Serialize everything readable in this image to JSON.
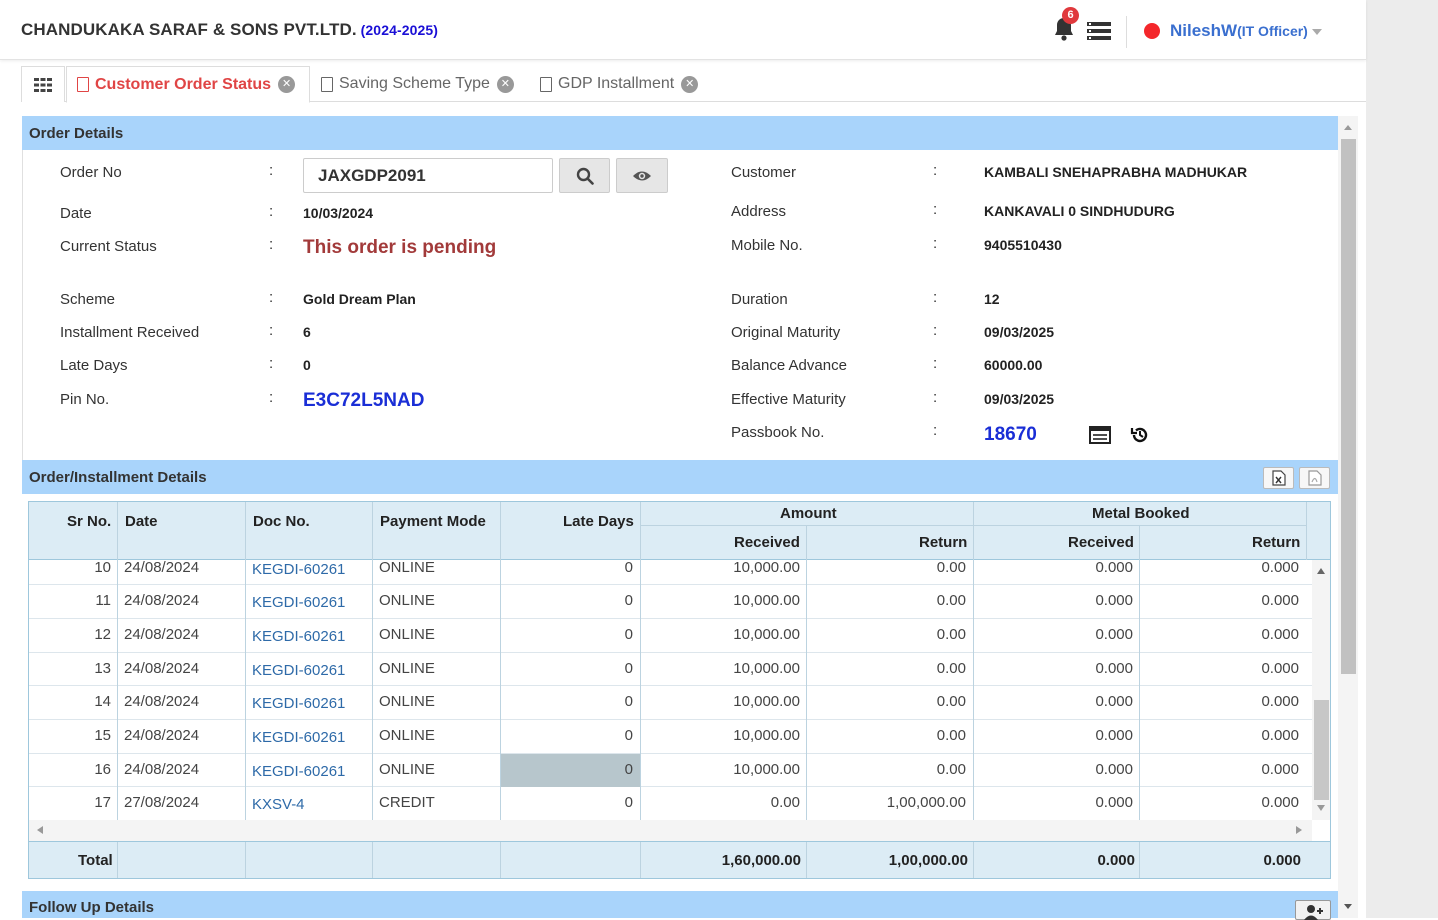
{
  "header": {
    "company": "CHANDUKAKA SARAF & SONS PVT.LTD.",
    "year": "(2024-2025)",
    "notification_count": "6",
    "user_name": "NileshW",
    "user_role": "(IT Officer)",
    "status_color": "#f4272b"
  },
  "tabs": [
    {
      "label": "Customer Order Status",
      "active": true
    },
    {
      "label": "Saving Scheme Type",
      "active": false
    },
    {
      "label": "GDP Installment",
      "active": false
    }
  ],
  "order_details": {
    "title": "Order Details",
    "left": {
      "order_no_label": "Order No",
      "order_no_value": "JAXGDP2091",
      "date_label": "Date",
      "date_value": "10/03/2024",
      "status_label": "Current Status",
      "status_value": "This order is pending",
      "scheme_label": "Scheme",
      "scheme_value": "Gold Dream Plan",
      "installment_label": "Installment Received",
      "installment_value": "6",
      "late_label": "Late Days",
      "late_value": "0",
      "pin_label": "Pin No.",
      "pin_value": "E3C72L5NAD"
    },
    "right": {
      "customer_label": "Customer",
      "customer_value": "KAMBALI SNEHAPRABHA MADHUKAR",
      "address_label": "Address",
      "address_value": "KANKAVALI 0 SINDHUDURG",
      "mobile_label": "Mobile No.",
      "mobile_value": "9405510430",
      "duration_label": "Duration",
      "duration_value": "12",
      "orig_label": "Original Maturity",
      "orig_value": "09/03/2025",
      "balance_label": "Balance Advance",
      "balance_value": "60000.00",
      "eff_label": "Effective Maturity",
      "eff_value": "09/03/2025",
      "passbook_label": "Passbook No.",
      "passbook_value": "18670"
    },
    "colon": ":"
  },
  "installments": {
    "title": "Order/Installment Details",
    "headers": {
      "sr": "Sr No.",
      "date": "Date",
      "doc": "Doc No.",
      "mode": "Payment Mode",
      "late": "Late Days",
      "amount": "Amount",
      "metal": "Metal Booked",
      "received": "Received",
      "return": "Return"
    },
    "rows": [
      {
        "sr": "10",
        "date": "24/08/2024",
        "doc": "KEGDI-60261",
        "mode": "ONLINE",
        "late": "0",
        "amt_rec": "10,000.00",
        "amt_ret": "0.00",
        "met_rec": "0.000",
        "met_ret": "0.000"
      },
      {
        "sr": "11",
        "date": "24/08/2024",
        "doc": "KEGDI-60261",
        "mode": "ONLINE",
        "late": "0",
        "amt_rec": "10,000.00",
        "amt_ret": "0.00",
        "met_rec": "0.000",
        "met_ret": "0.000"
      },
      {
        "sr": "12",
        "date": "24/08/2024",
        "doc": "KEGDI-60261",
        "mode": "ONLINE",
        "late": "0",
        "amt_rec": "10,000.00",
        "amt_ret": "0.00",
        "met_rec": "0.000",
        "met_ret": "0.000"
      },
      {
        "sr": "13",
        "date": "24/08/2024",
        "doc": "KEGDI-60261",
        "mode": "ONLINE",
        "late": "0",
        "amt_rec": "10,000.00",
        "amt_ret": "0.00",
        "met_rec": "0.000",
        "met_ret": "0.000"
      },
      {
        "sr": "14",
        "date": "24/08/2024",
        "doc": "KEGDI-60261",
        "mode": "ONLINE",
        "late": "0",
        "amt_rec": "10,000.00",
        "amt_ret": "0.00",
        "met_rec": "0.000",
        "met_ret": "0.000"
      },
      {
        "sr": "15",
        "date": "24/08/2024",
        "doc": "KEGDI-60261",
        "mode": "ONLINE",
        "late": "0",
        "amt_rec": "10,000.00",
        "amt_ret": "0.00",
        "met_rec": "0.000",
        "met_ret": "0.000"
      },
      {
        "sr": "16",
        "date": "24/08/2024",
        "doc": "KEGDI-60261",
        "mode": "ONLINE",
        "late": "0",
        "amt_rec": "10,000.00",
        "amt_ret": "0.00",
        "met_rec": "0.000",
        "met_ret": "0.000"
      },
      {
        "sr": "17",
        "date": "27/08/2024",
        "doc": "KXSV-4",
        "mode": "CREDIT",
        "late": "0",
        "amt_rec": "0.00",
        "amt_ret": "1,00,000.00",
        "met_rec": "0.000",
        "met_ret": "0.000"
      }
    ],
    "total": {
      "label": "Total",
      "amt_rec": "1,60,000.00",
      "amt_ret": "1,00,000.00",
      "met_rec": "0.000",
      "met_ret": "0.000"
    }
  },
  "follow_up": {
    "title": "Follow Up Details"
  }
}
